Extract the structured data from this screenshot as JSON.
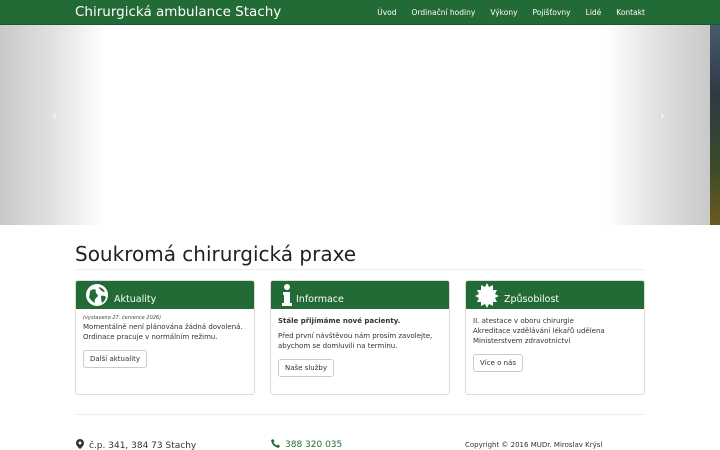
{
  "navbar": {
    "brand": "Chirurgická ambulance Stachy",
    "items": [
      {
        "label": "Úvod"
      },
      {
        "label": "Ordinační hodiny"
      },
      {
        "label": "Výkony"
      },
      {
        "label": "Pojišťovny"
      },
      {
        "label": "Lidé"
      },
      {
        "label": "Kontakt"
      }
    ]
  },
  "carousel": {
    "prev_label": "‹",
    "next_label": "›"
  },
  "main": {
    "title": "Soukromá chirurgická praxe"
  },
  "panels": [
    {
      "icon": "globe-icon",
      "title": "Aktuality",
      "note": "(vystaveno 27. července 2026)",
      "lines": [
        "Momentálně není plánována žádná dovolená.",
        "Ordinace pracuje v normálním režimu."
      ],
      "button": "Další aktuality"
    },
    {
      "icon": "info-icon",
      "title": "Informace",
      "bold": "Stále přijímáme nové pacienty.",
      "lines": [
        "Před první návštěvou nám prosím zavolejte,",
        "abychom se domluvili na termínu."
      ],
      "button": "Naše služby"
    },
    {
      "icon": "certificate-icon",
      "title": "Způsobilost",
      "lines": [
        "II. atestace v oboru chirurgie",
        "Akreditace vzdělávání lékařů udělena",
        "Ministerstvem zdravotnictví"
      ],
      "button": "Více o nás"
    }
  ],
  "footer": {
    "address": "č.p. 341, 384 73 Stachy",
    "address_icon": "map-marker-icon",
    "phone": "388 320 035",
    "phone_icon": "phone-icon",
    "copyright": "Copyright © 2016 MUDr. Miroslav Krýsl"
  },
  "colors": {
    "brand": "#226a36",
    "text": "#333333"
  }
}
